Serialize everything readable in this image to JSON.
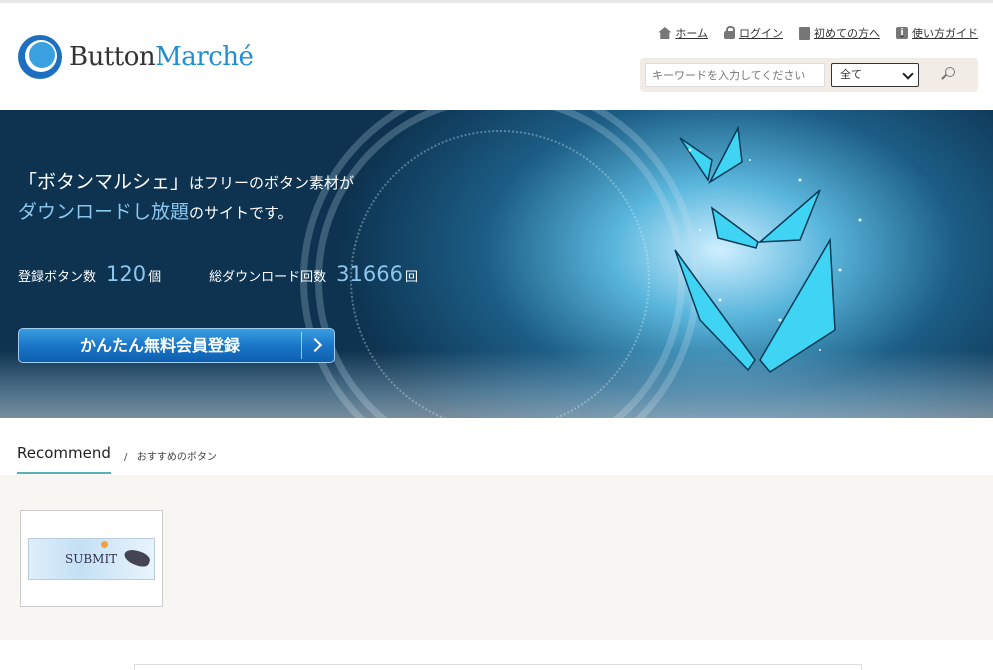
{
  "brand": {
    "part1": "Button",
    "part2": "Marché"
  },
  "nav": [
    {
      "label": "ホーム",
      "icon": "home-icon"
    },
    {
      "label": "ログイン",
      "icon": "lock-icon"
    },
    {
      "label": "初めての方へ",
      "icon": "book-icon"
    },
    {
      "label": "使い方ガイド",
      "icon": "info-icon"
    }
  ],
  "search": {
    "placeholder": "キーワードを入力してください",
    "category": "全て",
    "button_icon": "search-icon"
  },
  "hero": {
    "line1_a": "「ボタンマルシェ」",
    "line1_b": "はフリーのボタン素材が",
    "line2_a": "ダウンロードし放題",
    "line2_b": "のサイトです。",
    "buttons_label": "登録ボタン数",
    "buttons_count": "120",
    "buttons_unit": "個",
    "downloads_label": "総ダウンロード回数",
    "downloads_count": "31666",
    "downloads_unit": "回",
    "cta_label": "かんたん無料会員登録"
  },
  "recommend": {
    "title": "Recommend",
    "separator": "/",
    "subtitle": "おすすめのボタン",
    "items": [
      {
        "label": "SUBMIT"
      }
    ]
  },
  "colors": {
    "accent": "#1e8fd0",
    "cta": "#1a76c8",
    "highlight": "#8cc7ef",
    "underline": "#5bb0b0"
  }
}
